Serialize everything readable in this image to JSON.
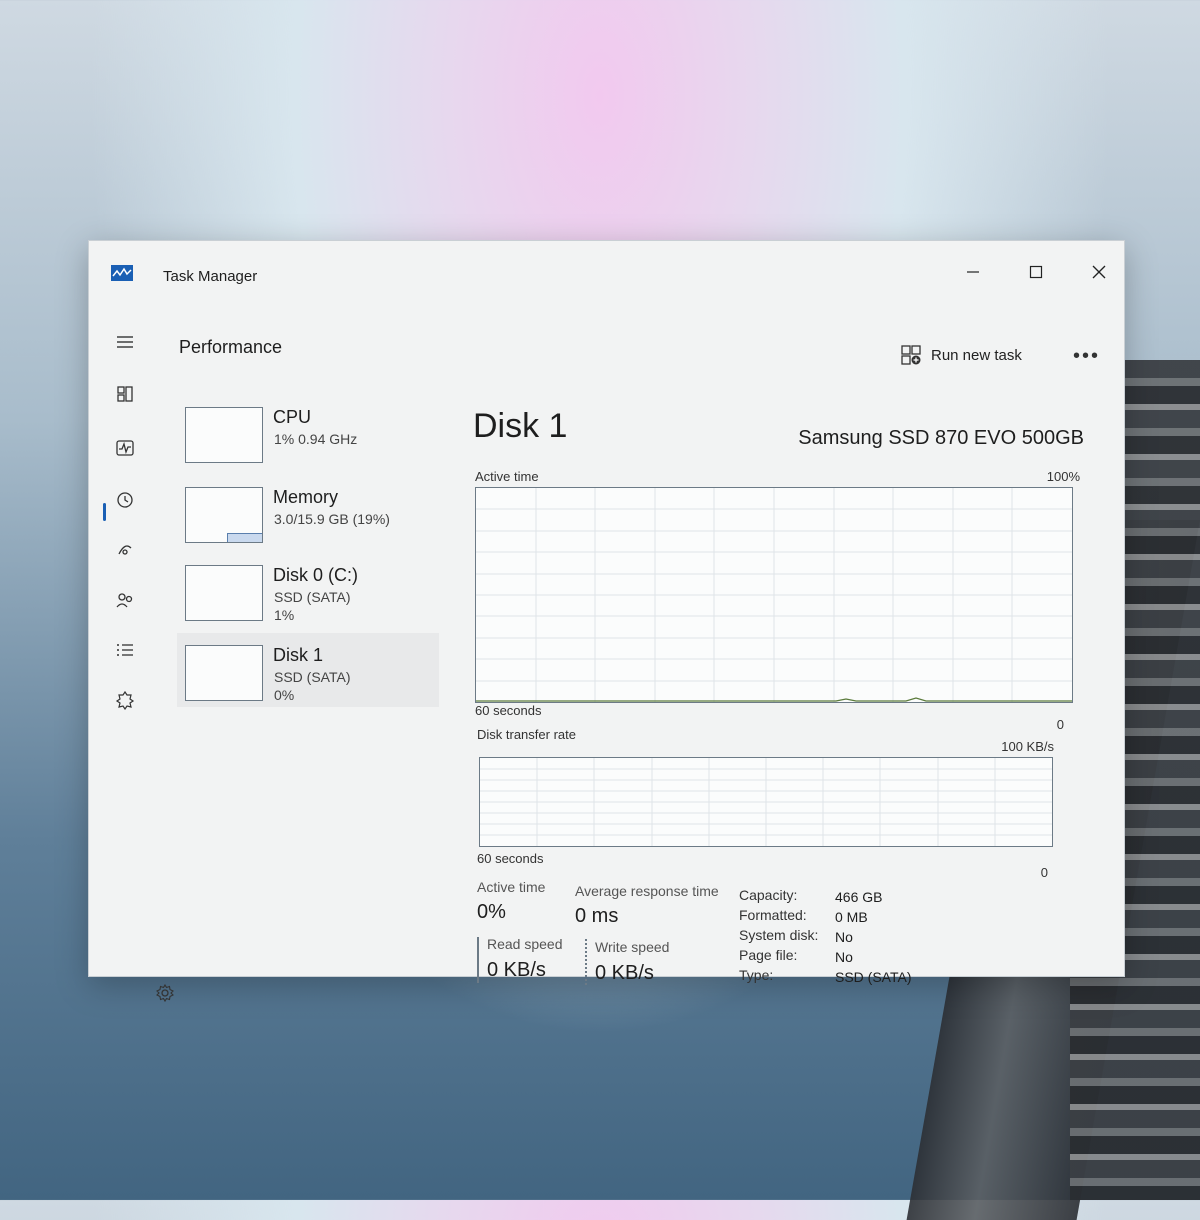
{
  "window": {
    "title": "Task Manager"
  },
  "header": {
    "title": "Performance",
    "run_task_label": "Run new task",
    "more_label": "•••"
  },
  "rail": {
    "items": [
      {
        "name": "hamburger-menu-icon"
      },
      {
        "name": "processes-icon"
      },
      {
        "name": "performance-icon",
        "active": true
      },
      {
        "name": "app-history-icon"
      },
      {
        "name": "startup-apps-icon"
      },
      {
        "name": "users-icon"
      },
      {
        "name": "details-icon"
      },
      {
        "name": "services-icon"
      }
    ],
    "settings_icon": "settings-gear-icon"
  },
  "devices": [
    {
      "name": "CPU",
      "line1": "1% 0.94 GHz",
      "line2": ""
    },
    {
      "name": "Memory",
      "line1": "3.0/15.9 GB (19%)",
      "line2": ""
    },
    {
      "name": "Disk 0 (C:)",
      "line1": "SSD (SATA)",
      "line2": "1%"
    },
    {
      "name": "Disk 1",
      "line1": "SSD (SATA)",
      "line2": "0%"
    }
  ],
  "detail": {
    "title": "Disk 1",
    "model": "Samsung SSD 870 EVO 500GB",
    "active_time_graph": {
      "label": "Active time",
      "max": "100%",
      "min": "0",
      "duration": "60 seconds"
    },
    "transfer_graph": {
      "label": "Disk transfer rate",
      "max": "100 KB/s",
      "min": "0",
      "duration": "60 seconds"
    },
    "stats": {
      "active_time_label": "Active time",
      "active_time_value": "0%",
      "response_label": "Average response time",
      "response_value": "0 ms",
      "read_label": "Read speed",
      "read_value": "0 KB/s",
      "write_label": "Write speed",
      "write_value": "0 KB/s"
    },
    "properties": [
      {
        "key": "Capacity:",
        "value": "466 GB"
      },
      {
        "key": "Formatted:",
        "value": "0 MB"
      },
      {
        "key": "System disk:",
        "value": "No"
      },
      {
        "key": "Page file:",
        "value": "No"
      },
      {
        "key": "Type:",
        "value": "SSD (SATA)"
      }
    ]
  },
  "colors": {
    "accent": "#1a5fb4",
    "graph_border": "#6c7a86"
  }
}
